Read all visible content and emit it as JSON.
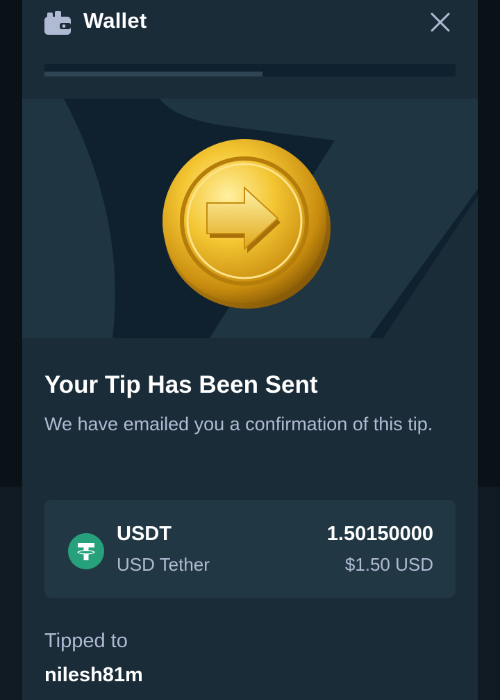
{
  "header": {
    "title": "Wallet",
    "icon": "wallet-icon",
    "close_icon": "close-icon"
  },
  "progress": {
    "fraction": 0.53
  },
  "hero": {
    "illustration": "gold-coin-arrow-icon"
  },
  "confirmation": {
    "title": "Your Tip Has Been Sent",
    "description": "We have emailed you a confirmation of this tip."
  },
  "tip": {
    "currency_code": "USDT",
    "currency_name": "USD Tether",
    "amount": "1.50150000",
    "amount_usd": "$1.50 USD",
    "currency_icon": "tether-icon"
  },
  "recipient": {
    "label": "Tipped to",
    "username": "nilesh81m"
  },
  "colors": {
    "background": "#1a2c38",
    "hero_background": "#0f212e",
    "card": "#213743",
    "muted_text": "#b1bad3",
    "tether_green": "#26a17b",
    "gold": "#e8b722"
  }
}
